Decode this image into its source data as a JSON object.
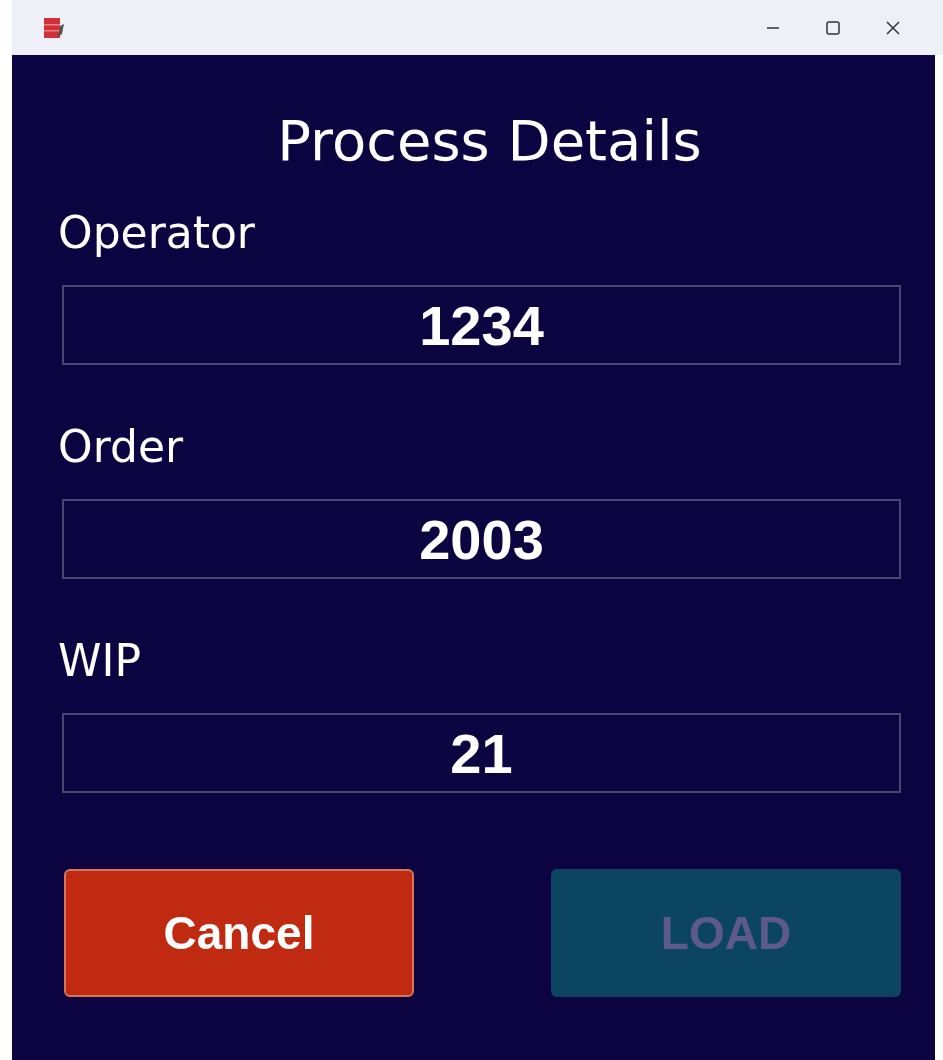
{
  "window": {
    "title": "Process Details"
  },
  "fields": [
    {
      "label": "Operator",
      "value": "1234"
    },
    {
      "label": "Order",
      "value": "2003"
    },
    {
      "label": "WIP",
      "value": "21"
    }
  ],
  "buttons": [
    {
      "label": "Cancel",
      "kind": "cancel",
      "disabled": false
    },
    {
      "label": "LOAD",
      "kind": "load",
      "disabled": true
    }
  ]
}
